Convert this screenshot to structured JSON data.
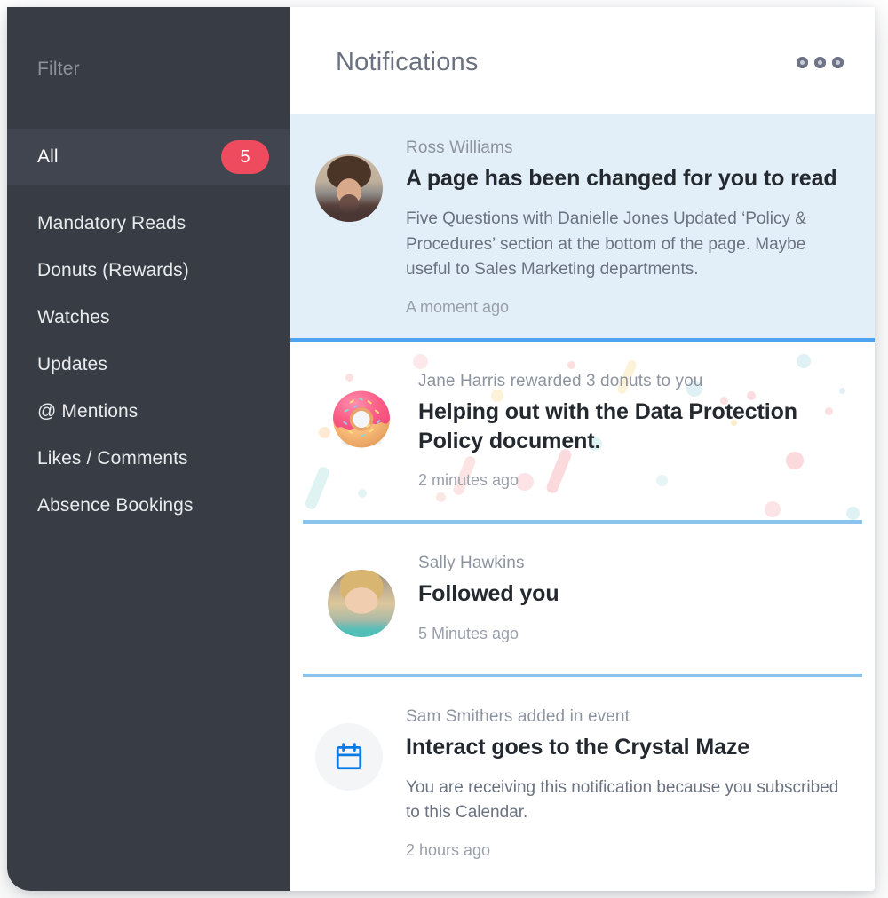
{
  "sidebar": {
    "filter_label": "Filter",
    "items": [
      {
        "label": "All",
        "badge": "5",
        "active": true
      },
      {
        "label": "Mandatory Reads",
        "badge": "",
        "active": false
      },
      {
        "label": "Donuts (Rewards)",
        "badge": "",
        "active": false
      },
      {
        "label": "Watches",
        "badge": "",
        "active": false
      },
      {
        "label": "Updates",
        "badge": "",
        "active": false
      },
      {
        "label": "@ Mentions",
        "badge": "",
        "active": false
      },
      {
        "label": "Likes / Comments",
        "badge": "",
        "active": false
      },
      {
        "label": "Absence Bookings",
        "badge": "",
        "active": false
      }
    ]
  },
  "header": {
    "title": "Notifications",
    "menu_icon": "kebab-menu-icon"
  },
  "notifications": [
    {
      "meta": "Ross Williams",
      "title": "A page has been changed for you to read",
      "description": "Five Questions with Danielle Jones Updated ‘Policy & Procedures’ section at the bottom of the page. Maybe useful to Sales Marketing departments.",
      "time": "A moment ago",
      "media": "avatar-photo-ross-williams",
      "state": "unread-highlight"
    },
    {
      "meta": "Jane Harris rewarded 3 donuts to you",
      "title": "Helping out with the Data Protection Policy document.",
      "description": "",
      "time": "2 minutes ago",
      "media": "donut-icon",
      "state": "confetti"
    },
    {
      "meta": "Sally Hawkins",
      "title": "Followed you",
      "description": "",
      "time": "5 Minutes ago",
      "media": "avatar-photo-sally-hawkins",
      "state": "read"
    },
    {
      "meta": "Sam Smithers added in event",
      "title": "Interact goes to the Crystal Maze",
      "description": "You are receiving this notification because you subscribed to this Calendar.",
      "time": "2 hours ago",
      "media": "calendar-icon",
      "state": "read"
    }
  ],
  "colors": {
    "sidebar_bg": "#383c45",
    "sidebar_active_bg": "#41454f",
    "badge_bg": "#ef4b5e",
    "highlight_card_bg": "#e2eff9",
    "divider_blue": "#8ac4ee",
    "accent_blue": "#0b7ae5",
    "title_text": "#24292f",
    "muted_text": "#8e949f"
  }
}
